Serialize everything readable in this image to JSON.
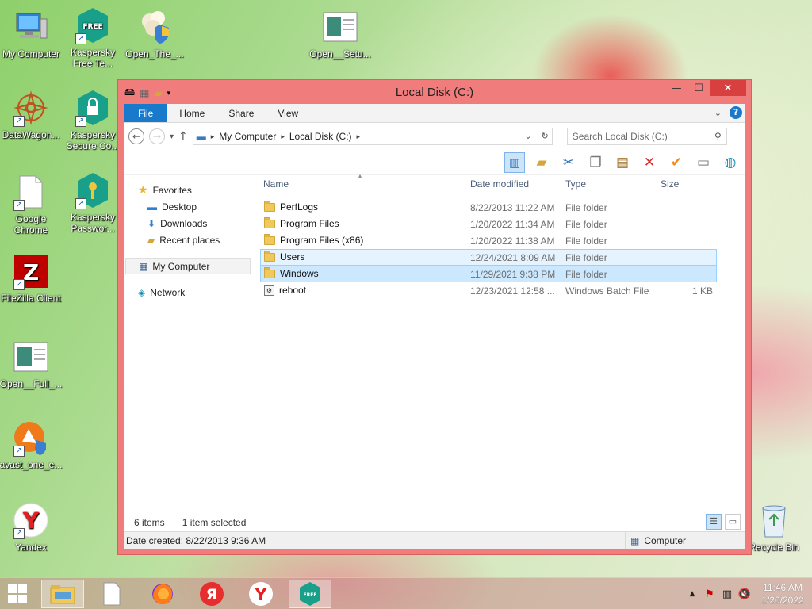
{
  "desktop": {
    "icons": [
      {
        "label": "My Computer"
      },
      {
        "label": "Kaspersky Free Te..."
      },
      {
        "label": "Open_The_..."
      },
      {
        "label": "Open__Setu..."
      },
      {
        "label": "DataWagon..."
      },
      {
        "label": "Kaspersky Secure Co..."
      },
      {
        "label": "Google Chrome"
      },
      {
        "label": "Kaspersky Passwor..."
      },
      {
        "label": "FileZilla Client"
      },
      {
        "label": "Open__Full_..."
      },
      {
        "label": "avast_one_e..."
      },
      {
        "label": "Yandex"
      },
      {
        "label": "Recycle Bin"
      }
    ],
    "free_badge": "FREE",
    "fz_glyph": "Z",
    "yandex_glyph": "Y"
  },
  "window": {
    "title": "Local Disk (C:)",
    "controls": {
      "minimize": "—",
      "maximize": "☐",
      "close": "✕"
    },
    "ribbon_tabs": [
      "File",
      "Home",
      "Share",
      "View"
    ],
    "help": "?",
    "address": {
      "segments": [
        "My Computer",
        "Local Disk (C:)"
      ],
      "search_placeholder": "Search Local Disk (C:)"
    },
    "nav": {
      "favorites": "Favorites",
      "favorite_items": [
        "Desktop",
        "Downloads",
        "Recent places"
      ],
      "my_computer": "My Computer",
      "network": "Network"
    },
    "columns": {
      "name": "Name",
      "date": "Date modified",
      "type": "Type",
      "size": "Size"
    },
    "files": [
      {
        "name": "PerfLogs",
        "date": "8/22/2013 11:22 AM",
        "type": "File folder",
        "size": ""
      },
      {
        "name": "Program Files",
        "date": "1/20/2022 11:34 AM",
        "type": "File folder",
        "size": ""
      },
      {
        "name": "Program Files (x86)",
        "date": "1/20/2022 11:38 AM",
        "type": "File folder",
        "size": ""
      },
      {
        "name": "Users",
        "date": "12/24/2021 8:09 AM",
        "type": "File folder",
        "size": ""
      },
      {
        "name": "Windows",
        "date": "11/29/2021 9:38 PM",
        "type": "File folder",
        "size": ""
      },
      {
        "name": "reboot",
        "date": "12/23/2021 12:58 ...",
        "type": "Windows Batch File",
        "size": "1 KB"
      }
    ],
    "status": {
      "items": "6 items",
      "selected": "1 item selected"
    },
    "details": {
      "created": "Date created: 8/22/2013 9:36 AM",
      "location": "Computer"
    }
  },
  "taskbar": {
    "yandex_browser_glyph": "Я",
    "yandex_glyph": "Y",
    "free_badge": "FREE",
    "time": "11:46 AM",
    "date": "1/20/2022"
  },
  "colors": {
    "window_frame": "#f07c7c",
    "file_tab": "#1979ca",
    "selection": "#cce8ff"
  }
}
